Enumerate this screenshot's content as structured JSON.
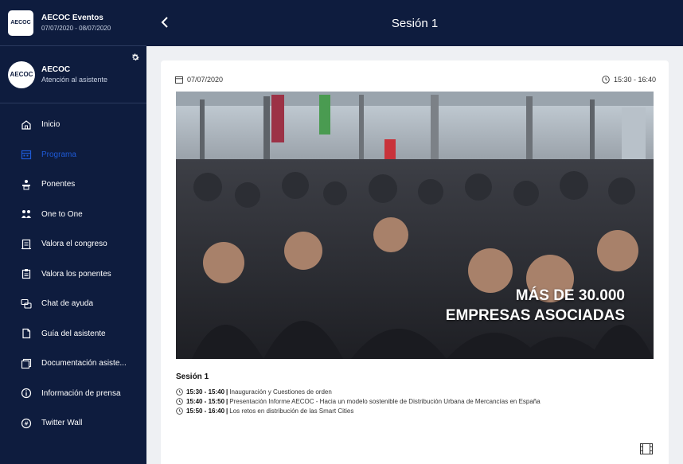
{
  "app": {
    "logo_text": "AECOC",
    "title": "AECOC Eventos",
    "dates": "07/07/2020 - 08/07/2020"
  },
  "profile": {
    "avatar_text": "AECOC",
    "name": "AECOC",
    "role": "Atención al asistente"
  },
  "nav": {
    "items": [
      {
        "label": "Inicio",
        "icon": "home-icon"
      },
      {
        "label": "Programa",
        "icon": "calendar-icon",
        "active": true
      },
      {
        "label": "Ponentes",
        "icon": "speaker-icon"
      },
      {
        "label": "One to One",
        "icon": "people-icon"
      },
      {
        "label": "Valora el congreso",
        "icon": "rating-icon"
      },
      {
        "label": "Valora los ponentes",
        "icon": "clipboard-icon"
      },
      {
        "label": "Chat de ayuda",
        "icon": "chat-icon"
      },
      {
        "label": "Guía del asistente",
        "icon": "document-icon"
      },
      {
        "label": "Documentación asiste...",
        "icon": "folder-icon"
      },
      {
        "label": "Información de prensa",
        "icon": "info-icon"
      },
      {
        "label": "Twitter Wall",
        "icon": "hashtag-icon"
      }
    ]
  },
  "header": {
    "title": "Sesión 1"
  },
  "session": {
    "date": "07/07/2020",
    "time_range": "15:30 - 16:40",
    "banner_line1": "MÁS DE 30.000",
    "banner_line2": "EMPRESAS ASOCIADAS",
    "title": "Sesión 1",
    "agenda": [
      {
        "time": "15:30 - 15:40",
        "separator": "|",
        "text": "Inauguración y Cuestiones de orden"
      },
      {
        "time": "15:40 - 15:50",
        "separator": "|",
        "text": "Presentación Informe AECOC - Hacia un modelo sostenible de Distribución Urbana de Mercancías en España"
      },
      {
        "time": "15:50 - 16:40",
        "separator": "|",
        "text": "Los retos en distribución de las Smart Cities"
      }
    ]
  },
  "colors": {
    "sidebar_bg": "#0e1c3e",
    "active_nav": "#1e5ad6",
    "content_bg": "#eef0f3"
  }
}
